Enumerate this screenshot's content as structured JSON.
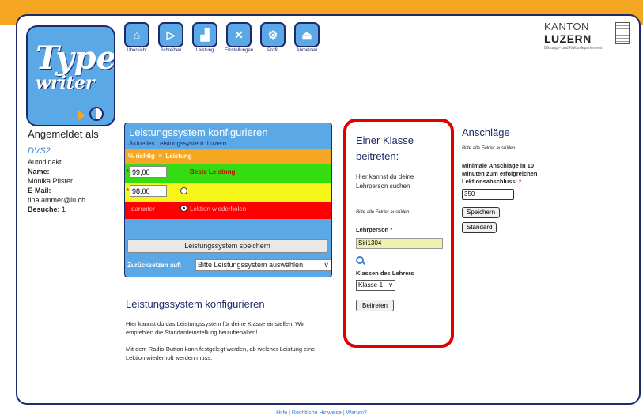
{
  "logo": {
    "line1": "Type",
    "line2": "writer"
  },
  "nav": [
    {
      "label": "Übersicht",
      "glyph": "⌂",
      "icon": "home-icon"
    },
    {
      "label": "Schreiben",
      "glyph": "▷",
      "icon": "play-icon"
    },
    {
      "label": "Leistung",
      "glyph": "▟",
      "icon": "chart-icon"
    },
    {
      "label": "Einstellungen",
      "glyph": "✕",
      "icon": "tools-icon"
    },
    {
      "label": "Profil",
      "glyph": "⚙",
      "icon": "gear-icon"
    },
    {
      "label": "Abmelden",
      "glyph": "⏏",
      "icon": "logout-icon"
    }
  ],
  "kanton": {
    "line1": "KANTON",
    "line2": "LUZERN",
    "line3": "Bildungs- und Kulturdepartement"
  },
  "user": {
    "heading": "Angemeldet als",
    "username": "DVS2",
    "role": "Autodidakt",
    "name_label": "Name:",
    "name": "Monika Pfister",
    "email_label": "E-Mail:",
    "email": "tina.ammer@lu.ch",
    "visits_label": "Besuche:",
    "visits": "1"
  },
  "config": {
    "title": "Leistungssystem konfigurieren",
    "current": "Aktuelles Leistungssystem: Luzern",
    "header_left": "% richtig",
    "header_eq": "=",
    "header_right": "Leistung",
    "row1_value": "99,00",
    "row1_label": "Beste Leistung",
    "row2_value": "98,00",
    "row3_left": "darunter",
    "row3_label": "Lektion wiederholen",
    "save_button": "Leistungssystem speichern",
    "reset_label": "Zurücksetzen auf:",
    "reset_select": "Bitte Leistungssystem auswählen",
    "mark": "*"
  },
  "info": {
    "title": "Leistungssystem konfigurieren",
    "p1": "Hier kannst du das Leistungssystem für deine Klasse einstellen. Wir empfehlen die Standardeinstellung beizubehalten!",
    "p2": "Mit dem Radio-Button kann festgelegt werden, ab welcher Leistung eine Lektion wiederholt werden muss."
  },
  "join": {
    "title": "Einer Klasse beitreten:",
    "intro": "Hier kannst du deine Lehrperson suchen",
    "note": "Bitte alle Felder ausfüllen!",
    "teacher_label": "Lehrperson",
    "teacher_value": "Siri1304",
    "classes_label": "Klassen des Lehrers",
    "class_select": "Klasse-1",
    "join_button": "Beitreten",
    "required_mark": "*"
  },
  "anschlaege": {
    "title": "Anschläge",
    "note": "Bitte alle Felder ausfüllen!",
    "label": "Minimale Anschläge in 10 Minuten zum erfolgreichen Lektionsabschluss:",
    "value": "350",
    "save_button": "Speichern",
    "default_button": "Standard",
    "required_mark": "*"
  },
  "footer": {
    "text": "Hilfe | Rechtliche Hinweise | Warum?"
  }
}
